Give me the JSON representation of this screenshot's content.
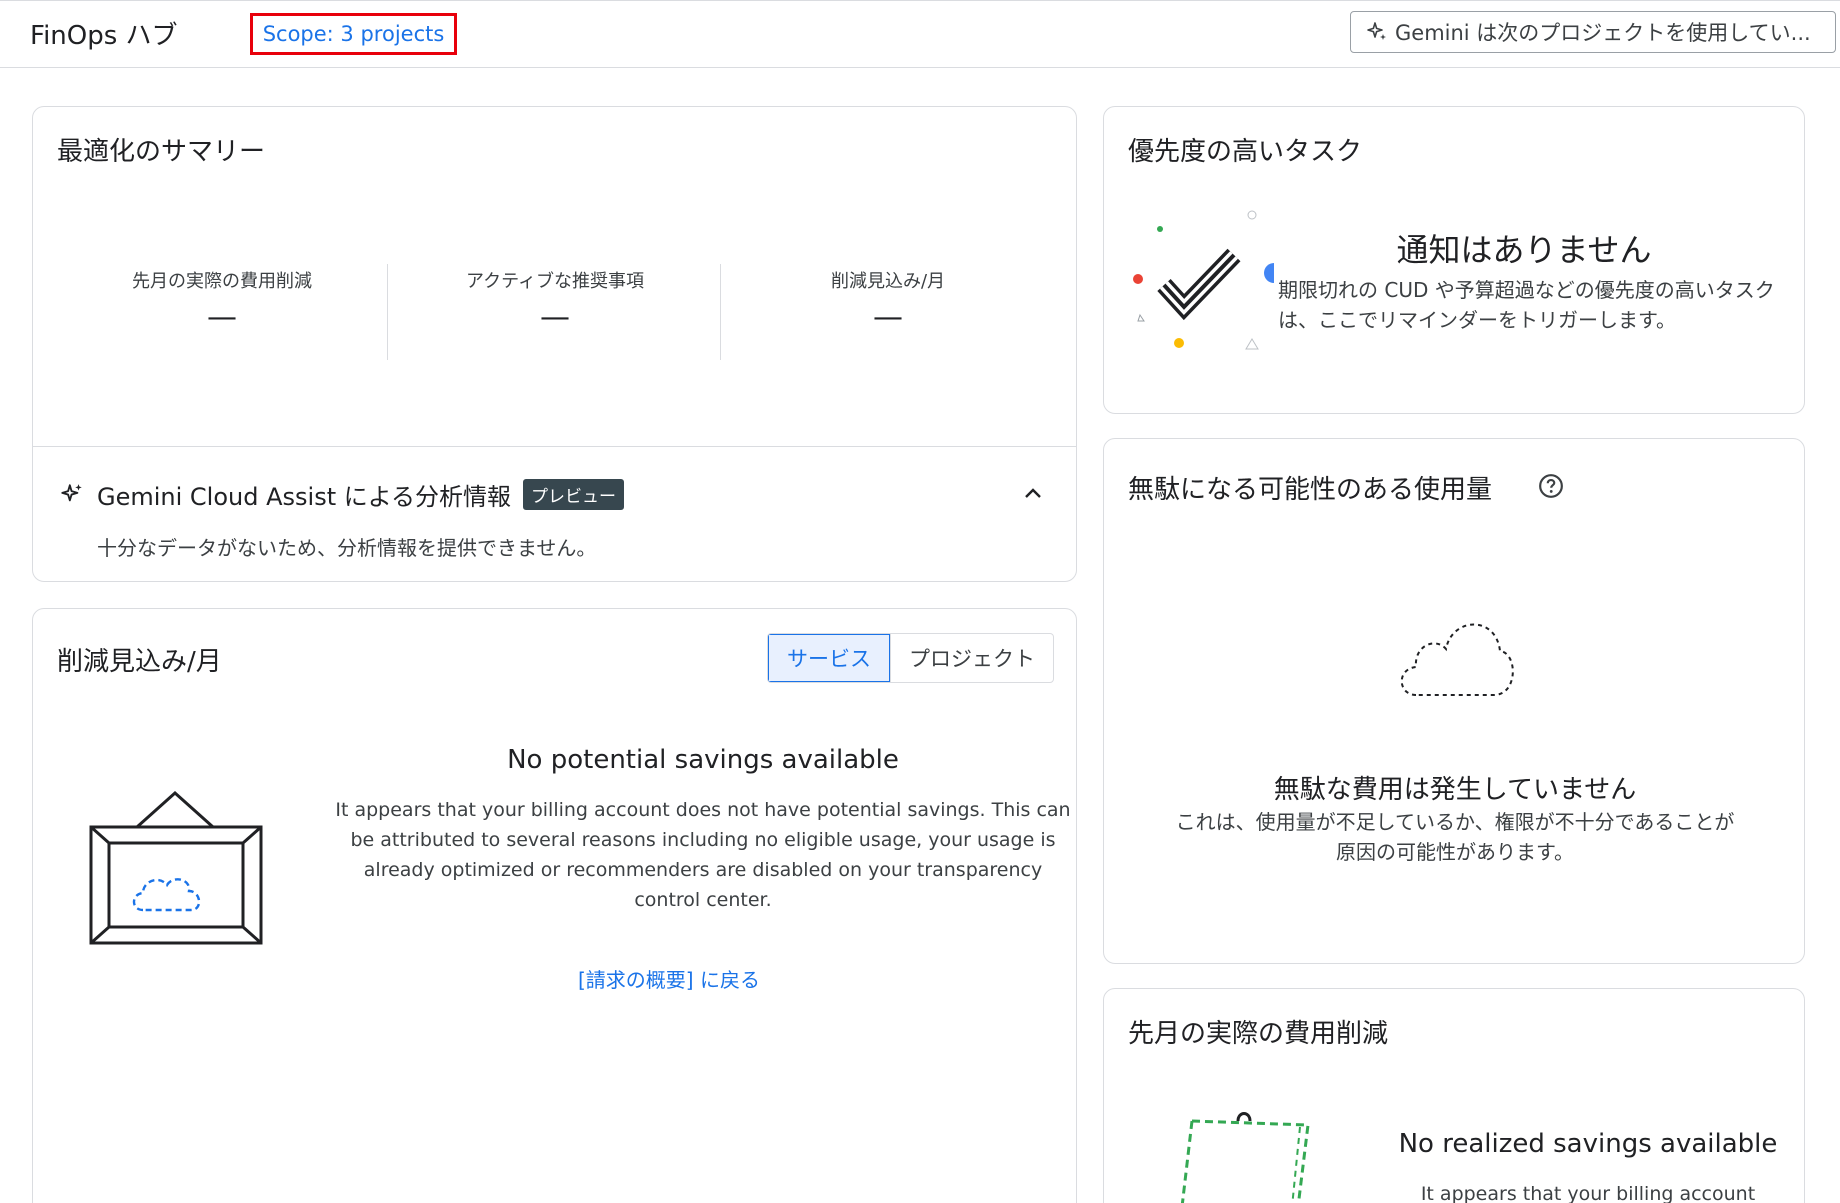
{
  "header": {
    "app_title": "FinOps ハブ",
    "scope_label": "Scope: 3 projects",
    "gemini_label": "Gemini は次のプロジェクトを使用してい..."
  },
  "summary": {
    "title": "最適化のサマリー",
    "metrics": [
      {
        "label": "先月の実際の費用削減",
        "value": "—"
      },
      {
        "label": "アクティブな推奨事項",
        "value": "—"
      },
      {
        "label": "削減見込み/月",
        "value": "—"
      }
    ],
    "insight_title": "Gemini Cloud Assist による分析情報",
    "insight_badge": "プレビュー",
    "insight_desc": "十分なデータがないため、分析情報を提供できません。"
  },
  "savings": {
    "title": "削減見込み/月",
    "toggle": [
      "サービス",
      "プロジェクト"
    ],
    "empty_title": "No potential savings available",
    "empty_desc": "It appears that your billing account does not have potential savings. This can be attributed to several reasons including no eligible usage, your usage is already optimized or recommenders are disabled on your transparency control center.",
    "back_link": "[請求の概要] に戻る"
  },
  "tasks": {
    "title": "優先度の高いタスク",
    "empty_title": "通知はありません",
    "empty_desc": "期限切れの CUD や予算超過などの優先度の高いタスクは、ここでリマインダーをトリガーします。"
  },
  "waste": {
    "title": "無駄になる可能性のある使用量",
    "empty_title": "無駄な費用は発生していません",
    "empty_desc": "これは、使用量が不足しているか、権限が不十分であることが原因の可能性があります。"
  },
  "realized": {
    "title": "先月の実際の費用削減",
    "empty_title": "No realized savings available",
    "empty_desc": "It appears that your billing account"
  },
  "colors": {
    "accent": "#1a73e8",
    "scope_border": "#e8000b",
    "badge_bg": "#37474f",
    "green_dash": "#34a853"
  }
}
